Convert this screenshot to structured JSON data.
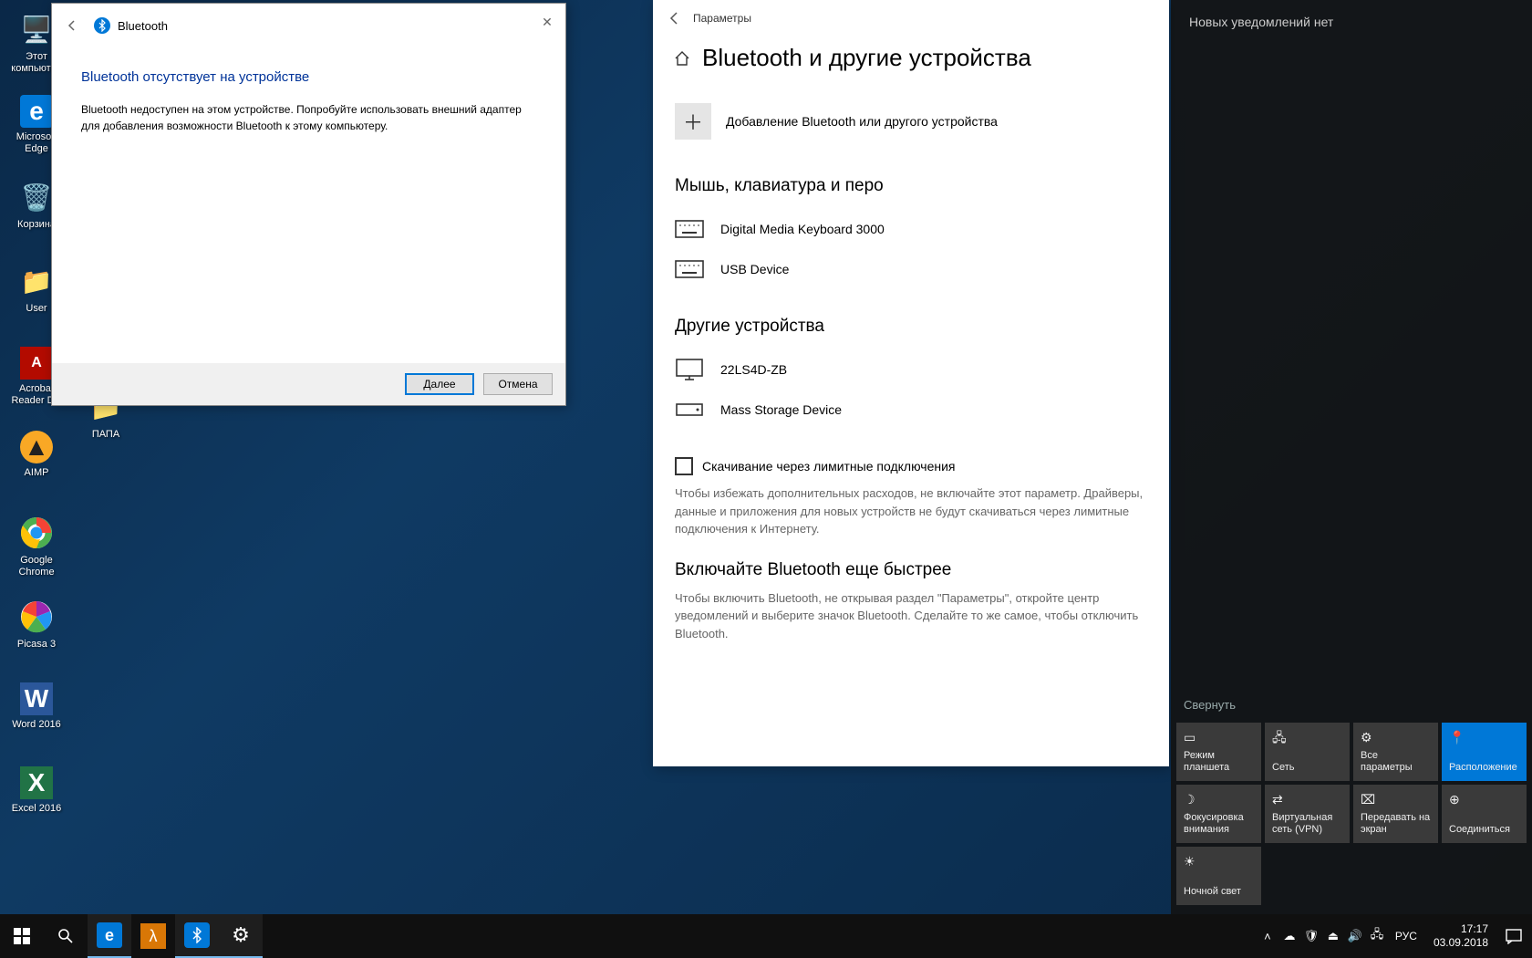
{
  "desktop": {
    "icons": [
      {
        "label": "Этот компьютер"
      },
      {
        "label": "Microsoft Edge"
      },
      {
        "label": "Корзина"
      },
      {
        "label": "User"
      },
      {
        "label": "Acrobat Reader DC"
      },
      {
        "label": "AIMP"
      },
      {
        "label": "Google Chrome"
      },
      {
        "label": "Picasa 3"
      },
      {
        "label": "Word 2016"
      },
      {
        "label": "Excel 2016"
      }
    ],
    "col2": {
      "label": "ПАПА"
    }
  },
  "dialog": {
    "title": "Bluetooth",
    "heading": "Bluetooth отсутствует на устройстве",
    "text": "Bluetooth недоступен на этом устройстве. Попробуйте использовать внешний адаптер для добавления возможности Bluetooth к этому компьютеру.",
    "next": "Далее",
    "cancel": "Отмена"
  },
  "settings": {
    "top_label": "Параметры",
    "title": "Bluetooth и другие устройства",
    "add_device": "Добавление Bluetooth или другого устройства",
    "section_mouse": "Мышь, клавиатура и перо",
    "devices_mouse": [
      {
        "label": "Digital Media Keyboard 3000"
      },
      {
        "label": "USB Device"
      }
    ],
    "section_other": "Другие устройства",
    "devices_other": [
      {
        "label": "22LS4D-ZB"
      },
      {
        "label": "Mass Storage Device"
      }
    ],
    "metered_label": "Скачивание через лимитные подключения",
    "metered_help": "Чтобы избежать дополнительных расходов, не включайте этот параметр. Драйверы, данные и приложения для новых устройств не будут скачиваться через лимитные подключения к Интернету.",
    "fast_heading": "Включайте Bluetooth еще быстрее",
    "fast_text": "Чтобы включить Bluetooth, не открывая раздел \"Параметры\", откройте центр уведомлений и выберите значок Bluetooth. Сделайте то же самое, чтобы отключить Bluetooth."
  },
  "action_center": {
    "header": "Новых уведомлений нет",
    "collapse": "Свернуть",
    "tiles": [
      {
        "label": "Режим планшета",
        "active": false
      },
      {
        "label": "Сеть",
        "active": false
      },
      {
        "label": "Все параметры",
        "active": false
      },
      {
        "label": "Расположение",
        "active": true
      },
      {
        "label": "Фокусировка внимания",
        "active": false
      },
      {
        "label": "Виртуальная сеть (VPN)",
        "active": false
      },
      {
        "label": "Передавать на экран",
        "active": false
      },
      {
        "label": "Соединиться",
        "active": false
      },
      {
        "label": "Ночной свет",
        "active": false
      }
    ]
  },
  "taskbar": {
    "lang": "РУС",
    "time": "17:17",
    "date": "03.09.2018"
  }
}
